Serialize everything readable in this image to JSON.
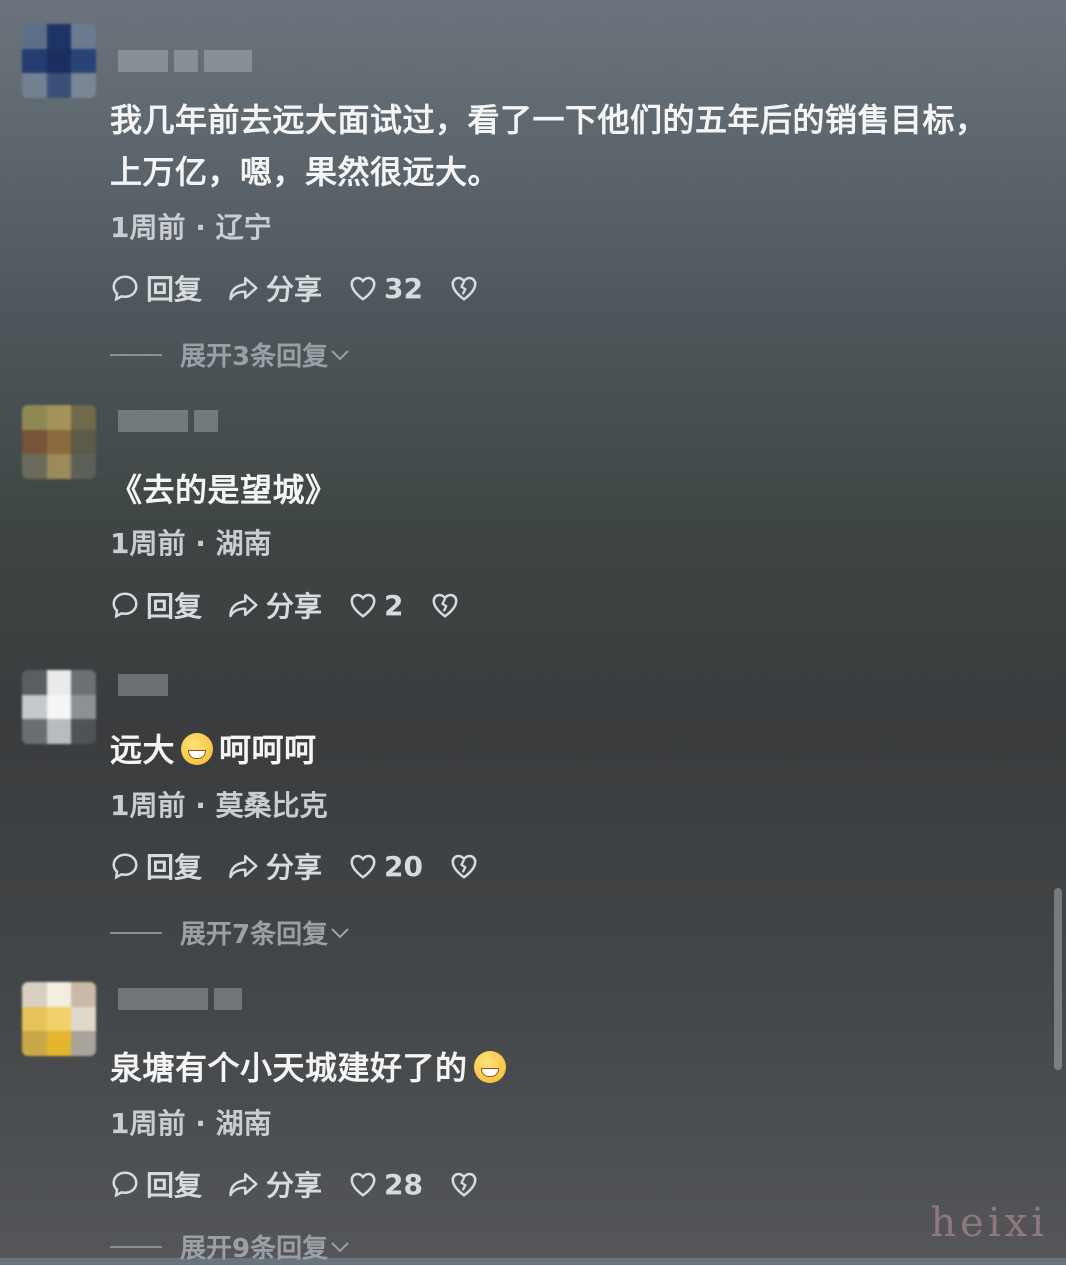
{
  "comments": [
    {
      "text": "我几年前去远大面试过，看了一下他们的五年后的销售目标，上万亿，嗯，果然很远大。",
      "time": "1周前",
      "location": "辽宁",
      "reply_label": "回复",
      "share_label": "分享",
      "likes": "32",
      "expand_label": "展开3条回复"
    },
    {
      "text": "《去的是望城》",
      "time": "1周前",
      "location": "湖南",
      "reply_label": "回复",
      "share_label": "分享",
      "likes": "2"
    },
    {
      "text_before": "远大",
      "emoji": "rolling-on-floor-laughing-emoji",
      "text_after": "呵呵呵",
      "time": "1周前",
      "location": "莫桑比克",
      "reply_label": "回复",
      "share_label": "分享",
      "likes": "20",
      "expand_label": "展开7条回复"
    },
    {
      "text": "泉塘有个小天城建好了的",
      "emoji": "grinning-face-emoji",
      "time": "1周前",
      "location": "湖南",
      "reply_label": "回复",
      "share_label": "分享",
      "likes": "28",
      "expand_label": "展开9条回复"
    }
  ],
  "meta_separator": "·",
  "watermark": "heixi",
  "colors": {
    "text_primary": "#f5f5f5",
    "text_secondary": "#c9cdd0",
    "text_muted": "#9aa0a5"
  }
}
